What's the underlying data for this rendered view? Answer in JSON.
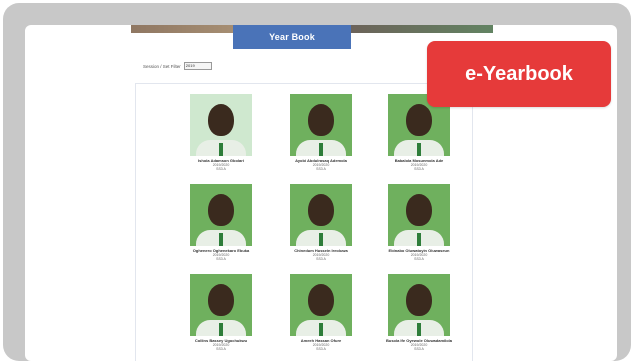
{
  "header": {
    "banner_title": "Year Book"
  },
  "filter": {
    "label": "Session / Set Filter",
    "selected": "2019"
  },
  "badge": {
    "label": "e-Yearbook"
  },
  "students": [
    {
      "name": "Ishola Adamson Gbolari",
      "line1": "2019/2020",
      "line2": "SS3 A"
    },
    {
      "name": "Ayobi Abdulrasaq Ademola",
      "line1": "2019/2020",
      "line2": "SS3 A"
    },
    {
      "name": "Babalola Mosunmola Ade",
      "line1": "2019/2020",
      "line2": "SS3 A"
    },
    {
      "name": "Oghenero Oghenekaro Ebuka",
      "line1": "2019/2020",
      "line2": "SS3 A"
    },
    {
      "name": "Chinedum Hussein Ireoluwa",
      "line1": "2019/2020",
      "line2": "SS3 A"
    },
    {
      "name": "Ebinabo Oluwatoyin Oluwaseun",
      "line1": "2019/2020",
      "line2": "SS3 A"
    },
    {
      "name": "Collins Bassey Ugochukwu",
      "line1": "2019/2020",
      "line2": "SS3 A"
    },
    {
      "name": "Ameeh Hassan Ofure",
      "line1": "2019/2020",
      "line2": "SS3 A"
    },
    {
      "name": "Busola Ife Oyewole Oluwadamilola",
      "line1": "2019/2020",
      "line2": "SS3 A"
    }
  ]
}
